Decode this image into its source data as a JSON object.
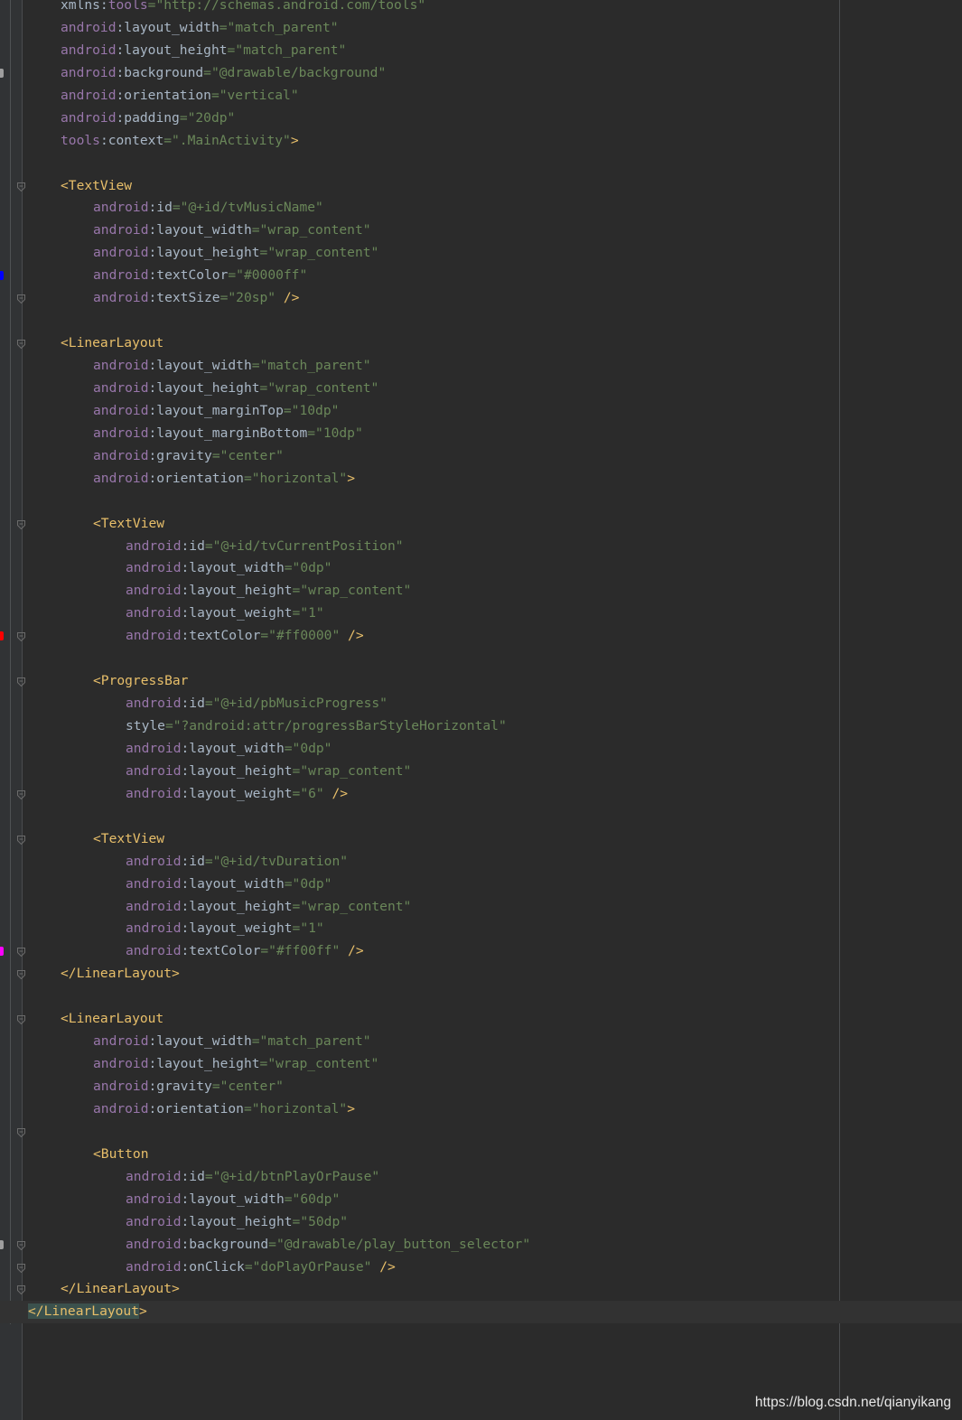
{
  "editor": {
    "lines": [
      {
        "indent": 1,
        "tokens": [
          {
            "t": "plain",
            "v": "xmlns:"
          },
          {
            "t": "ns",
            "v": "tools"
          },
          {
            "t": "val",
            "v": "=\"http://schemas.android.com/tools\""
          }
        ]
      },
      {
        "indent": 1,
        "tokens": [
          {
            "t": "ns",
            "v": "android"
          },
          {
            "t": "plain",
            "v": ":layout_width"
          },
          {
            "t": "val",
            "v": "=\"match_parent\""
          }
        ]
      },
      {
        "indent": 1,
        "tokens": [
          {
            "t": "ns",
            "v": "android"
          },
          {
            "t": "plain",
            "v": ":layout_height"
          },
          {
            "t": "val",
            "v": "=\"match_parent\""
          }
        ]
      },
      {
        "indent": 1,
        "tokens": [
          {
            "t": "ns",
            "v": "android"
          },
          {
            "t": "plain",
            "v": ":background"
          },
          {
            "t": "val",
            "v": "=\"@drawable/background\""
          }
        ]
      },
      {
        "indent": 1,
        "tokens": [
          {
            "t": "ns",
            "v": "android"
          },
          {
            "t": "plain",
            "v": ":orientation"
          },
          {
            "t": "val",
            "v": "=\"vertical\""
          }
        ]
      },
      {
        "indent": 1,
        "tokens": [
          {
            "t": "ns",
            "v": "android"
          },
          {
            "t": "plain",
            "v": ":padding"
          },
          {
            "t": "val",
            "v": "=\"20dp\""
          }
        ]
      },
      {
        "indent": 1,
        "tokens": [
          {
            "t": "ns",
            "v": "tools"
          },
          {
            "t": "plain",
            "v": ":context"
          },
          {
            "t": "val",
            "v": "=\".MainActivity\""
          },
          {
            "t": "tag",
            "v": ">"
          }
        ]
      },
      {
        "indent": 0,
        "tokens": []
      },
      {
        "indent": 1,
        "tokens": [
          {
            "t": "tag",
            "v": "<TextView"
          }
        ]
      },
      {
        "indent": 2,
        "tokens": [
          {
            "t": "ns",
            "v": "android"
          },
          {
            "t": "plain",
            "v": ":id"
          },
          {
            "t": "val",
            "v": "=\"@+id/tvMusicName\""
          }
        ]
      },
      {
        "indent": 2,
        "tokens": [
          {
            "t": "ns",
            "v": "android"
          },
          {
            "t": "plain",
            "v": ":layout_width"
          },
          {
            "t": "val",
            "v": "=\"wrap_content\""
          }
        ]
      },
      {
        "indent": 2,
        "tokens": [
          {
            "t": "ns",
            "v": "android"
          },
          {
            "t": "plain",
            "v": ":layout_height"
          },
          {
            "t": "val",
            "v": "=\"wrap_content\""
          }
        ]
      },
      {
        "indent": 2,
        "tokens": [
          {
            "t": "ns",
            "v": "android"
          },
          {
            "t": "plain",
            "v": ":textColor"
          },
          {
            "t": "val",
            "v": "=\"#0000ff\""
          }
        ]
      },
      {
        "indent": 2,
        "tokens": [
          {
            "t": "ns",
            "v": "android"
          },
          {
            "t": "plain",
            "v": ":textSize"
          },
          {
            "t": "val",
            "v": "=\"20sp\""
          },
          {
            "t": "tag",
            "v": " />"
          }
        ]
      },
      {
        "indent": 0,
        "tokens": []
      },
      {
        "indent": 1,
        "tokens": [
          {
            "t": "tag",
            "v": "<LinearLayout"
          }
        ]
      },
      {
        "indent": 2,
        "tokens": [
          {
            "t": "ns",
            "v": "android"
          },
          {
            "t": "plain",
            "v": ":layout_width"
          },
          {
            "t": "val",
            "v": "=\"match_parent\""
          }
        ]
      },
      {
        "indent": 2,
        "tokens": [
          {
            "t": "ns",
            "v": "android"
          },
          {
            "t": "plain",
            "v": ":layout_height"
          },
          {
            "t": "val",
            "v": "=\"wrap_content\""
          }
        ]
      },
      {
        "indent": 2,
        "tokens": [
          {
            "t": "ns",
            "v": "android"
          },
          {
            "t": "plain",
            "v": ":layout_marginTop"
          },
          {
            "t": "val",
            "v": "=\"10dp\""
          }
        ]
      },
      {
        "indent": 2,
        "tokens": [
          {
            "t": "ns",
            "v": "android"
          },
          {
            "t": "plain",
            "v": ":layout_marginBottom"
          },
          {
            "t": "val",
            "v": "=\"10dp\""
          }
        ]
      },
      {
        "indent": 2,
        "tokens": [
          {
            "t": "ns",
            "v": "android"
          },
          {
            "t": "plain",
            "v": ":gravity"
          },
          {
            "t": "val",
            "v": "=\"center\""
          }
        ]
      },
      {
        "indent": 2,
        "tokens": [
          {
            "t": "ns",
            "v": "android"
          },
          {
            "t": "plain",
            "v": ":orientation"
          },
          {
            "t": "val",
            "v": "=\"horizontal\""
          },
          {
            "t": "tag",
            "v": ">"
          }
        ]
      },
      {
        "indent": 0,
        "tokens": []
      },
      {
        "indent": 2,
        "tokens": [
          {
            "t": "tag",
            "v": "<TextView"
          }
        ]
      },
      {
        "indent": 3,
        "tokens": [
          {
            "t": "ns",
            "v": "android"
          },
          {
            "t": "plain",
            "v": ":id"
          },
          {
            "t": "val",
            "v": "=\"@+id/tvCurrentPosition\""
          }
        ]
      },
      {
        "indent": 3,
        "tokens": [
          {
            "t": "ns",
            "v": "android"
          },
          {
            "t": "plain",
            "v": ":layout_width"
          },
          {
            "t": "val",
            "v": "=\"0dp\""
          }
        ]
      },
      {
        "indent": 3,
        "tokens": [
          {
            "t": "ns",
            "v": "android"
          },
          {
            "t": "plain",
            "v": ":layout_height"
          },
          {
            "t": "val",
            "v": "=\"wrap_content\""
          }
        ]
      },
      {
        "indent": 3,
        "tokens": [
          {
            "t": "ns",
            "v": "android"
          },
          {
            "t": "plain",
            "v": ":layout_weight"
          },
          {
            "t": "val",
            "v": "=\"1\""
          }
        ]
      },
      {
        "indent": 3,
        "tokens": [
          {
            "t": "ns",
            "v": "android"
          },
          {
            "t": "plain",
            "v": ":textColor"
          },
          {
            "t": "val",
            "v": "=\"#ff0000\""
          },
          {
            "t": "tag",
            "v": " />"
          }
        ]
      },
      {
        "indent": 0,
        "tokens": []
      },
      {
        "indent": 2,
        "tokens": [
          {
            "t": "tag",
            "v": "<ProgressBar"
          }
        ]
      },
      {
        "indent": 3,
        "tokens": [
          {
            "t": "ns",
            "v": "android"
          },
          {
            "t": "plain",
            "v": ":id"
          },
          {
            "t": "val",
            "v": "=\"@+id/pbMusicProgress\""
          }
        ]
      },
      {
        "indent": 3,
        "tokens": [
          {
            "t": "plain",
            "v": "style"
          },
          {
            "t": "val",
            "v": "=\"?android:attr/progressBarStyleHorizontal\""
          }
        ]
      },
      {
        "indent": 3,
        "tokens": [
          {
            "t": "ns",
            "v": "android"
          },
          {
            "t": "plain",
            "v": ":layout_width"
          },
          {
            "t": "val",
            "v": "=\"0dp\""
          }
        ]
      },
      {
        "indent": 3,
        "tokens": [
          {
            "t": "ns",
            "v": "android"
          },
          {
            "t": "plain",
            "v": ":layout_height"
          },
          {
            "t": "val",
            "v": "=\"wrap_content\""
          }
        ]
      },
      {
        "indent": 3,
        "tokens": [
          {
            "t": "ns",
            "v": "android"
          },
          {
            "t": "plain",
            "v": ":layout_weight"
          },
          {
            "t": "val",
            "v": "=\"6\""
          },
          {
            "t": "tag",
            "v": " />"
          }
        ]
      },
      {
        "indent": 0,
        "tokens": []
      },
      {
        "indent": 2,
        "tokens": [
          {
            "t": "tag",
            "v": "<TextView"
          }
        ]
      },
      {
        "indent": 3,
        "tokens": [
          {
            "t": "ns",
            "v": "android"
          },
          {
            "t": "plain",
            "v": ":id"
          },
          {
            "t": "val",
            "v": "=\"@+id/tvDuration\""
          }
        ]
      },
      {
        "indent": 3,
        "tokens": [
          {
            "t": "ns",
            "v": "android"
          },
          {
            "t": "plain",
            "v": ":layout_width"
          },
          {
            "t": "val",
            "v": "=\"0dp\""
          }
        ]
      },
      {
        "indent": 3,
        "tokens": [
          {
            "t": "ns",
            "v": "android"
          },
          {
            "t": "plain",
            "v": ":layout_height"
          },
          {
            "t": "val",
            "v": "=\"wrap_content\""
          }
        ]
      },
      {
        "indent": 3,
        "tokens": [
          {
            "t": "ns",
            "v": "android"
          },
          {
            "t": "plain",
            "v": ":layout_weight"
          },
          {
            "t": "val",
            "v": "=\"1\""
          }
        ]
      },
      {
        "indent": 3,
        "tokens": [
          {
            "t": "ns",
            "v": "android"
          },
          {
            "t": "plain",
            "v": ":textColor"
          },
          {
            "t": "val",
            "v": "=\"#ff00ff\""
          },
          {
            "t": "tag",
            "v": " />"
          }
        ]
      },
      {
        "indent": 1,
        "tokens": [
          {
            "t": "tag",
            "v": "</LinearLayout>"
          }
        ]
      },
      {
        "indent": 0,
        "tokens": []
      },
      {
        "indent": 1,
        "tokens": [
          {
            "t": "tag",
            "v": "<LinearLayout"
          }
        ]
      },
      {
        "indent": 2,
        "tokens": [
          {
            "t": "ns",
            "v": "android"
          },
          {
            "t": "plain",
            "v": ":layout_width"
          },
          {
            "t": "val",
            "v": "=\"match_parent\""
          }
        ]
      },
      {
        "indent": 2,
        "tokens": [
          {
            "t": "ns",
            "v": "android"
          },
          {
            "t": "plain",
            "v": ":layout_height"
          },
          {
            "t": "val",
            "v": "=\"wrap_content\""
          }
        ]
      },
      {
        "indent": 2,
        "tokens": [
          {
            "t": "ns",
            "v": "android"
          },
          {
            "t": "plain",
            "v": ":gravity"
          },
          {
            "t": "val",
            "v": "=\"center\""
          }
        ]
      },
      {
        "indent": 2,
        "tokens": [
          {
            "t": "ns",
            "v": "android"
          },
          {
            "t": "plain",
            "v": ":orientation"
          },
          {
            "t": "val",
            "v": "=\"horizontal\""
          },
          {
            "t": "tag",
            "v": ">"
          }
        ]
      },
      {
        "indent": 0,
        "tokens": []
      },
      {
        "indent": 2,
        "tokens": [
          {
            "t": "tag",
            "v": "<Button"
          }
        ]
      },
      {
        "indent": 3,
        "tokens": [
          {
            "t": "ns",
            "v": "android"
          },
          {
            "t": "plain",
            "v": ":id"
          },
          {
            "t": "val",
            "v": "=\"@+id/btnPlayOrPause\""
          }
        ]
      },
      {
        "indent": 3,
        "tokens": [
          {
            "t": "ns",
            "v": "android"
          },
          {
            "t": "plain",
            "v": ":layout_width"
          },
          {
            "t": "val",
            "v": "=\"60dp\""
          }
        ]
      },
      {
        "indent": 3,
        "tokens": [
          {
            "t": "ns",
            "v": "android"
          },
          {
            "t": "plain",
            "v": ":layout_height"
          },
          {
            "t": "val",
            "v": "=\"50dp\""
          }
        ]
      },
      {
        "indent": 3,
        "tokens": [
          {
            "t": "ns",
            "v": "android"
          },
          {
            "t": "plain",
            "v": ":background"
          },
          {
            "t": "val",
            "v": "=\"@drawable/play_button_selector\""
          }
        ]
      },
      {
        "indent": 3,
        "tokens": [
          {
            "t": "ns",
            "v": "android"
          },
          {
            "t": "plain",
            "v": ":onClick"
          },
          {
            "t": "val",
            "v": "=\"doPlayOrPause\""
          },
          {
            "t": "tag",
            "v": " />"
          }
        ]
      },
      {
        "indent": 1,
        "tokens": [
          {
            "t": "tag",
            "v": "</LinearLayout>"
          }
        ]
      },
      {
        "indent": 0,
        "current": true,
        "tokens": [
          {
            "t": "taghl",
            "v": "</LinearLayout"
          },
          {
            "t": "tag",
            "v": ">"
          }
        ]
      }
    ],
    "fold_lines": [
      8,
      13,
      15,
      23,
      28,
      30,
      35,
      37,
      42,
      43,
      45,
      50,
      55,
      56,
      57
    ],
    "gutter_markers": [
      {
        "line": 3,
        "color": "#9e9e9e"
      },
      {
        "line": 12,
        "color": "#0000ff"
      },
      {
        "line": 28,
        "color": "#ff0000"
      },
      {
        "line": 42,
        "color": "#ff00ff"
      },
      {
        "line": 55,
        "color": "#9e9e9e"
      }
    ]
  },
  "watermark": "https://blog.csdn.net/qianyikang"
}
